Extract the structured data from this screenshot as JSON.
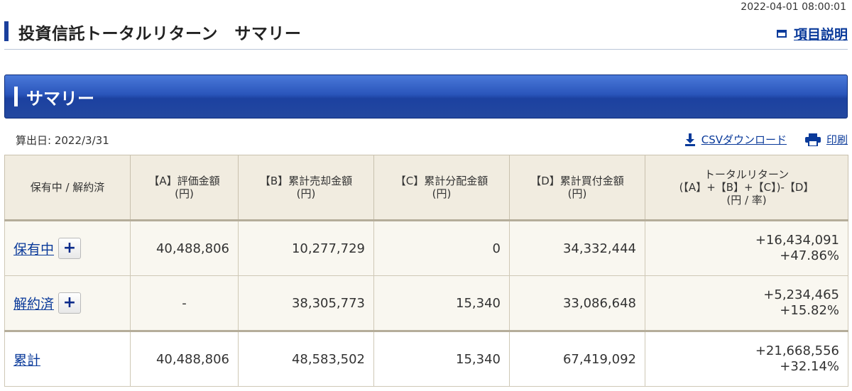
{
  "timestamp": "2022-04-01 08:00:01",
  "header": {
    "title": "投資信託トータルリターン　サマリー",
    "help_label": "項目説明"
  },
  "section": {
    "title": "サマリー"
  },
  "calc_date": "算出日: 2022/3/31",
  "tools": {
    "csv_label": "CSVダウンロード",
    "print_label": "印刷"
  },
  "table": {
    "headers": {
      "status": "保有中 / 解約済",
      "a_line1": "【A】評価金額",
      "a_line2": "(円)",
      "b_line1": "【B】累計売却金額",
      "b_line2": "(円)",
      "c_line1": "【C】累計分配金額",
      "c_line2": "(円)",
      "d_line1": "【D】累計買付金額",
      "d_line2": "(円)",
      "tr_line1": "トータルリターン",
      "tr_line2": "(【A】+【B】+【C】)-【D】",
      "tr_line3": "(円 / 率)"
    },
    "rows": [
      {
        "name": "保有中",
        "expand_label": "+",
        "a": "40,488,806",
        "b": "10,277,729",
        "c": "0",
        "d": "34,332,444",
        "tr_amount": "+16,434,091",
        "tr_rate": "+47.86%"
      },
      {
        "name": "解約済",
        "expand_label": "+",
        "a": "-",
        "b": "38,305,773",
        "c": "15,340",
        "d": "33,086,648",
        "tr_amount": "+5,234,465",
        "tr_rate": "+15.82%"
      },
      {
        "name": "累計",
        "a": "40,488,806",
        "b": "48,583,502",
        "c": "15,340",
        "d": "67,419,092",
        "tr_amount": "+21,668,556",
        "tr_rate": "+32.14%"
      }
    ]
  },
  "colors": {
    "accent_blue": "#1c41a0",
    "link": "#0a3a9a",
    "positive": "#e52a2a",
    "header_bg": "#f1ece0"
  }
}
